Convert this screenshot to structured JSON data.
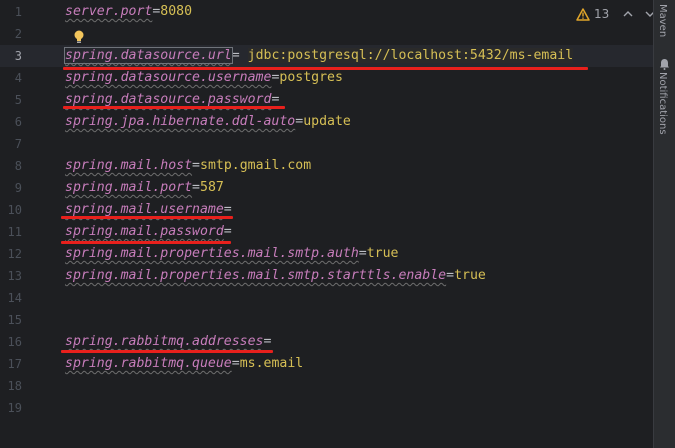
{
  "editor": {
    "lines": [
      {
        "num": "1",
        "key": "server.port",
        "eq": "=",
        "value": "8080"
      },
      {
        "num": "2",
        "key": "",
        "eq": "",
        "value": ""
      },
      {
        "num": "3",
        "key": "spring.datasource.url",
        "eq": "= ",
        "value": "jdbc:postgresql://localhost:5432/ms-email"
      },
      {
        "num": "4",
        "key": "spring.datasource.username",
        "eq": "=",
        "value": "postgres"
      },
      {
        "num": "5",
        "key": "spring.datasource.password",
        "eq": "=",
        "value": ""
      },
      {
        "num": "6",
        "key": "spring.jpa.hibernate.ddl-auto",
        "eq": "=",
        "value": "update"
      },
      {
        "num": "7",
        "key": "",
        "eq": "",
        "value": ""
      },
      {
        "num": "8",
        "key": "spring.mail.host",
        "eq": "=",
        "value": "smtp.gmail.com"
      },
      {
        "num": "9",
        "key": "spring.mail.port",
        "eq": "=",
        "value": "587"
      },
      {
        "num": "10",
        "key": "spring.mail.username",
        "eq": "=",
        "value": ""
      },
      {
        "num": "11",
        "key": "spring.mail.password",
        "eq": "=",
        "value": ""
      },
      {
        "num": "12",
        "key": "spring.mail.properties.mail.smtp.auth",
        "eq": "=",
        "value": "true"
      },
      {
        "num": "13",
        "key": "spring.mail.properties.mail.smtp.starttls.enable",
        "eq": "=",
        "value": "true"
      },
      {
        "num": "14",
        "key": "",
        "eq": "",
        "value": ""
      },
      {
        "num": "15",
        "key": "",
        "eq": "",
        "value": ""
      },
      {
        "num": "16",
        "key": "spring.rabbitmq.addresses",
        "eq": "=",
        "value": ""
      },
      {
        "num": "17",
        "key": "spring.rabbitmq.queue",
        "eq": "=",
        "value": "ms.email"
      },
      {
        "num": "18",
        "key": "",
        "eq": "",
        "value": ""
      },
      {
        "num": "19",
        "key": "",
        "eq": "",
        "value": ""
      }
    ],
    "current_line": 3
  },
  "toolbar": {
    "warning_count": "13"
  },
  "sidebar": {
    "maven_label": "Maven",
    "notifications_label": "Notifications"
  },
  "colors": {
    "background": "#1e1f22",
    "key": "#c77dbb",
    "value": "#d6bf55",
    "annotation_red": "#e8201c",
    "warning": "#e0a52a"
  }
}
